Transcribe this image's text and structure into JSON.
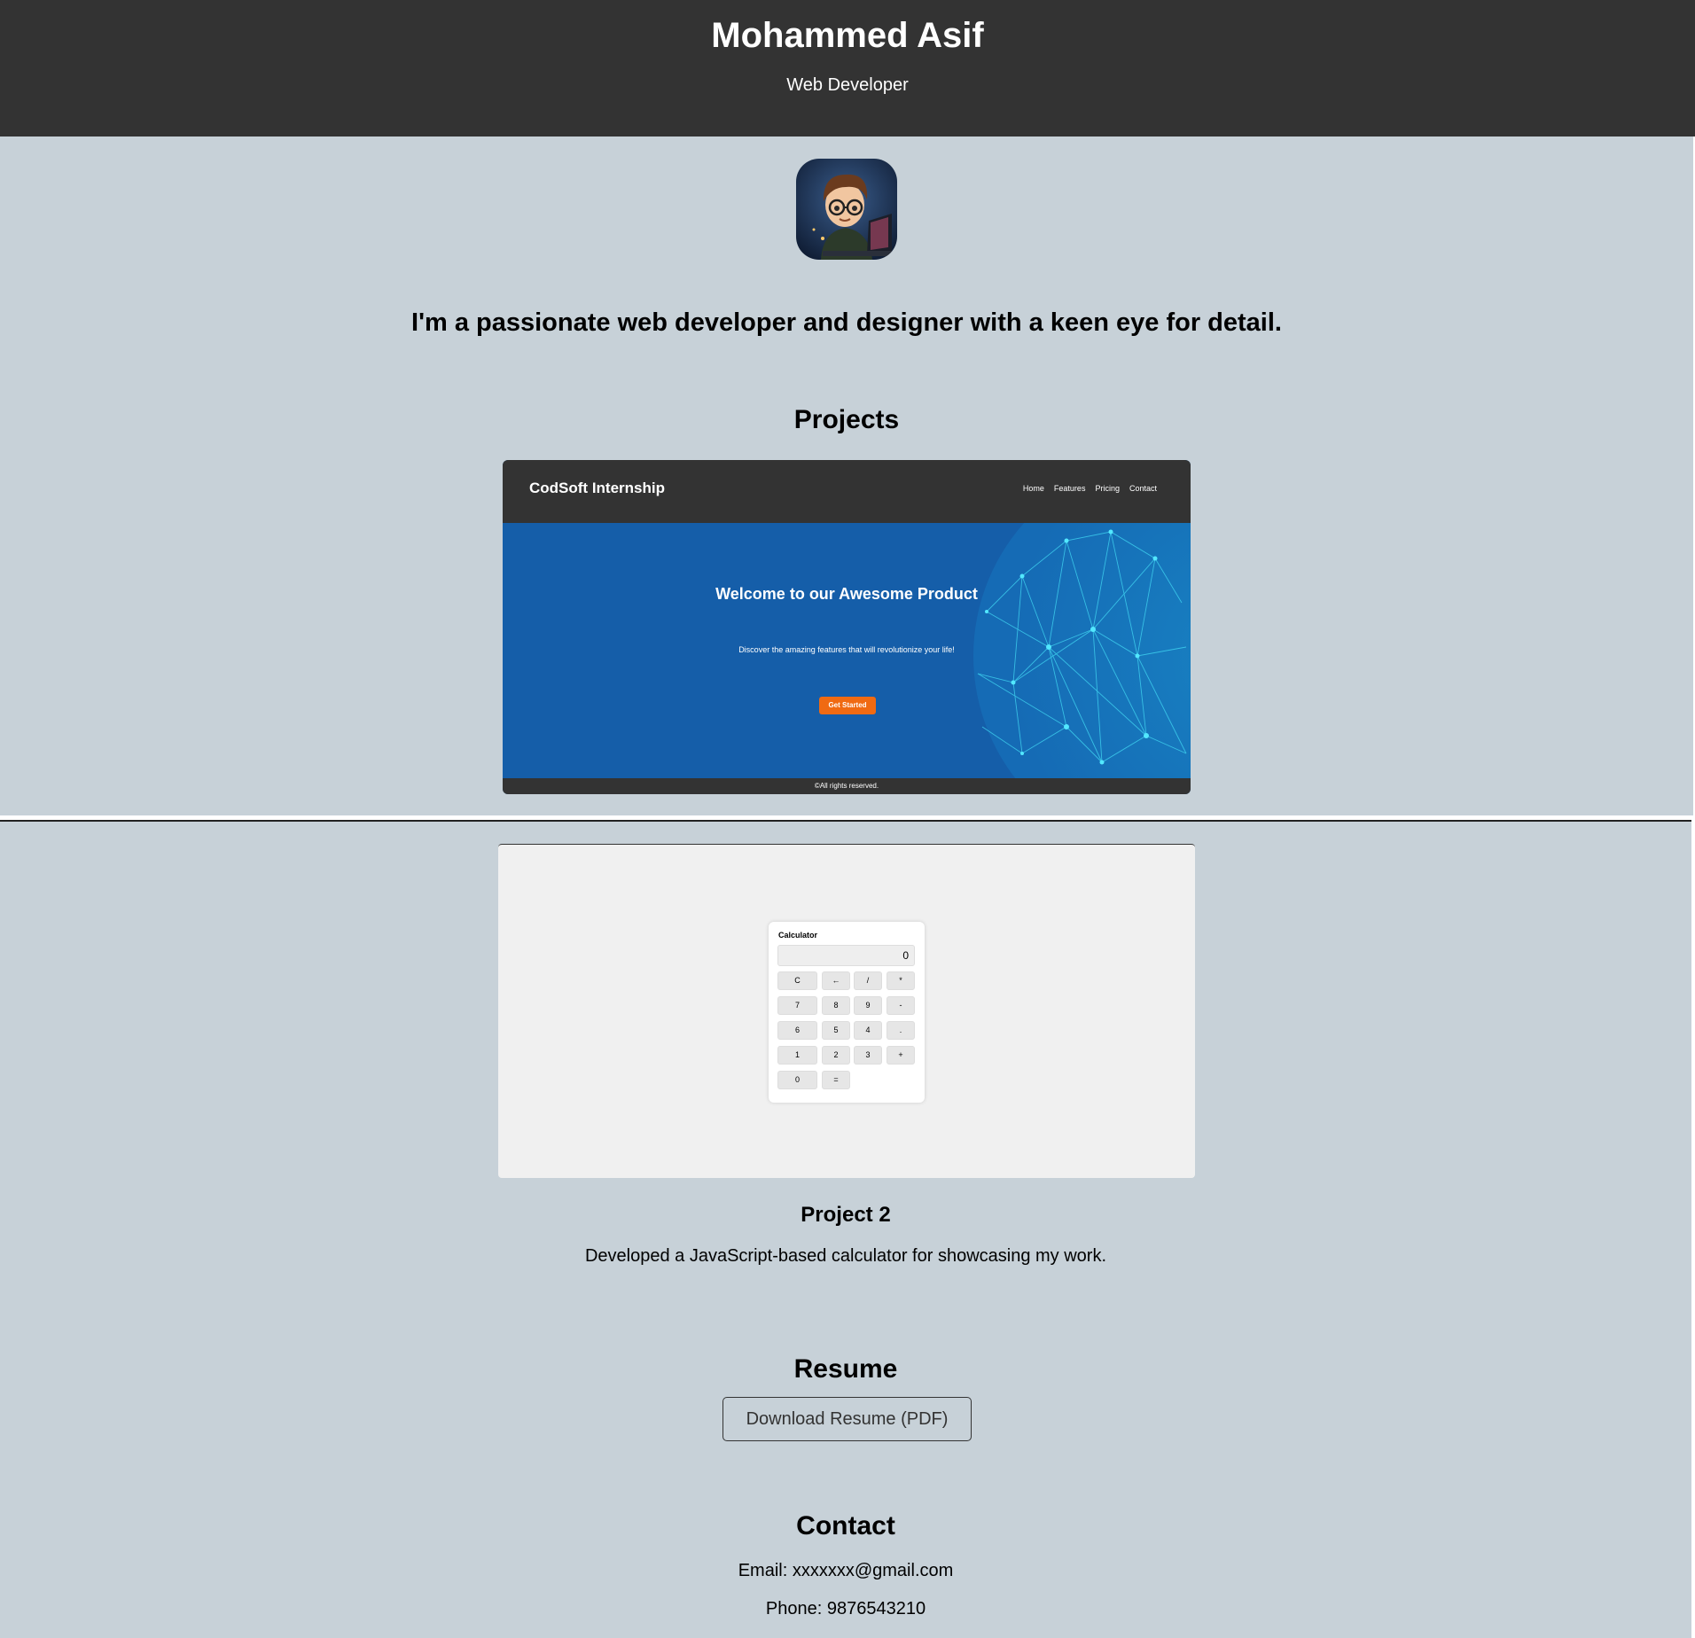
{
  "header": {
    "name": "Mohammed Asif",
    "role": "Web Developer"
  },
  "about": {
    "tagline": "I'm a passionate web developer and designer with a keen eye for detail."
  },
  "projects": {
    "heading": "Projects",
    "project1": {
      "brand": "CodSoft Internship",
      "nav": [
        "Home",
        "Features",
        "Pricing",
        "Contact"
      ],
      "hero_title": "Welcome to our Awesome Product",
      "hero_desc": "Discover the amazing features that will revolutionize your life!",
      "cta": "Get Started",
      "footer": "©All rights reserved."
    },
    "project2": {
      "calc_title": "Calculator",
      "display": "0",
      "keys": [
        "C",
        "←",
        "/",
        "*",
        "7",
        "8",
        "9",
        "-",
        "6",
        "5",
        "4",
        ".",
        "1",
        "2",
        "3",
        "+",
        "0",
        "="
      ],
      "title": "Project 2",
      "description": "Developed a JavaScript-based calculator for showcasing my work."
    }
  },
  "resume": {
    "heading": "Resume",
    "button_label": "Download Resume (PDF)"
  },
  "contact": {
    "heading": "Contact",
    "email": "Email: xxxxxxx@gmail.com",
    "phone": "Phone: 9876543210"
  },
  "colors": {
    "header_bg": "#333333",
    "section_bg": "#c7d1d8",
    "hero_blue": "#155ea9",
    "cta_orange": "#f06a12"
  }
}
